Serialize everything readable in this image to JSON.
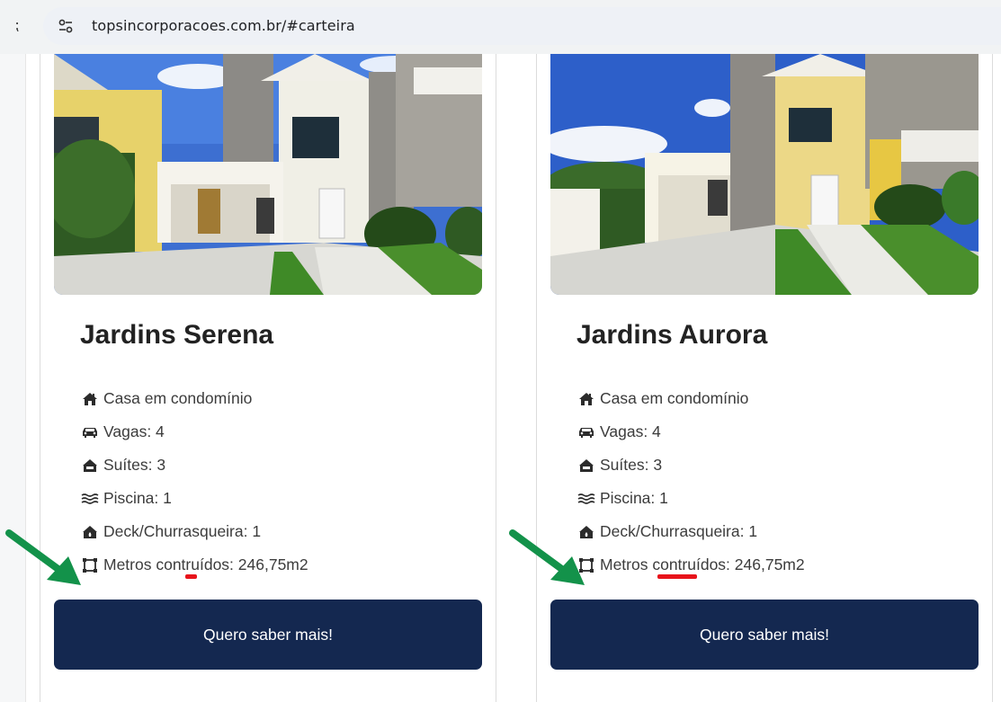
{
  "browser": {
    "url": "topsincorporacoes.com.br/#carteira"
  },
  "colors": {
    "button_bg": "#142850",
    "arrow": "#13924a",
    "annotation_underline": "#e8141b"
  },
  "cards": [
    {
      "title": "Jardins Serena",
      "features": [
        {
          "icon": "home-icon",
          "label": "Casa em condomínio"
        },
        {
          "icon": "car-icon",
          "label": "Vagas: 4"
        },
        {
          "icon": "bed-icon",
          "label": "Suítes: 3"
        },
        {
          "icon": "water-waves-icon",
          "label": "Piscina: 1"
        },
        {
          "icon": "house-fire-icon",
          "label": "Deck/Churrasqueira: 1"
        },
        {
          "icon": "area-square-icon",
          "label": "Metros contruídos: 246,75m2"
        }
      ],
      "button_label": "Quero saber mais!"
    },
    {
      "title": "Jardins Aurora",
      "features": [
        {
          "icon": "home-icon",
          "label": "Casa em condomínio"
        },
        {
          "icon": "car-icon",
          "label": "Vagas: 4"
        },
        {
          "icon": "bed-icon",
          "label": "Suítes: 3"
        },
        {
          "icon": "water-waves-icon",
          "label": "Piscina: 1"
        },
        {
          "icon": "house-fire-icon",
          "label": "Deck/Churrasqueira: 1"
        },
        {
          "icon": "area-square-icon",
          "label": "Metros contruídos: 246,75m2"
        }
      ],
      "button_label": "Quero saber mais!"
    }
  ]
}
